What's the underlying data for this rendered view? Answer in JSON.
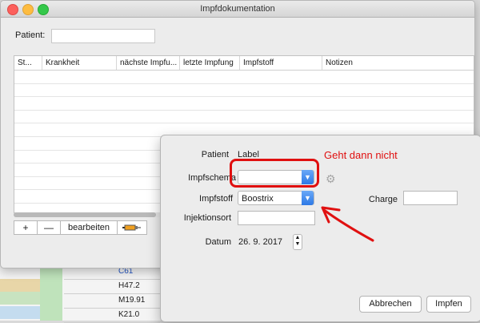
{
  "window": {
    "title": "Impfdokumentation"
  },
  "patient": {
    "label": "Patient:",
    "value": ""
  },
  "table": {
    "columns": [
      "St...",
      "Krankheit",
      "nächste Impfu...",
      "letzte Impfung",
      "Impfstoff",
      "Notizen"
    ]
  },
  "toolbar": {
    "add": "+",
    "remove": "—",
    "edit": "bearbeiten"
  },
  "background_rows": [
    "C61",
    "H47.2",
    "M19.91",
    "K21.0"
  ],
  "dialog": {
    "patient_label": "Patient",
    "patient_value": "Label",
    "schema_label": "Impfschema",
    "schema_value": "",
    "vaccine_label": "Impfstoff",
    "vaccine_value": "Boostrix",
    "charge_label": "Charge",
    "site_label": "Injektionsort",
    "date_label": "Datum",
    "date_value": "26. 9. 2017",
    "cancel": "Abbrechen",
    "submit": "Impfen"
  },
  "annotation": {
    "text": "Geht dann nicht"
  }
}
